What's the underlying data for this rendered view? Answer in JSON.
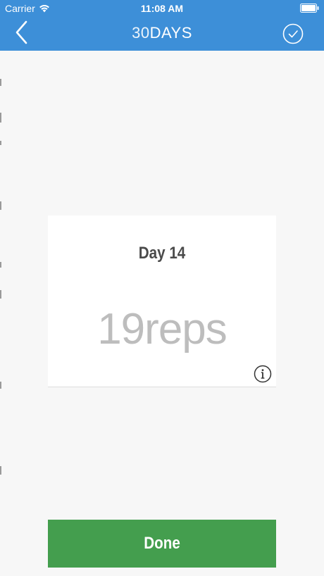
{
  "status_bar": {
    "carrier": "Carrier",
    "time": "11:08 AM"
  },
  "header": {
    "title_number": "30",
    "title_word": "DAYS",
    "back_icon": "chevron-left-icon",
    "confirm_icon": "check-circle-icon"
  },
  "card": {
    "day_label": "Day 14",
    "reps_count": "19",
    "reps_unit": "reps",
    "info_icon": "info-circle-icon"
  },
  "footer": {
    "done_label": "Done"
  },
  "colors": {
    "header": "#3d8fd8",
    "background": "#f7f7f7",
    "card": "#ffffff",
    "done_button": "#449e4e"
  }
}
